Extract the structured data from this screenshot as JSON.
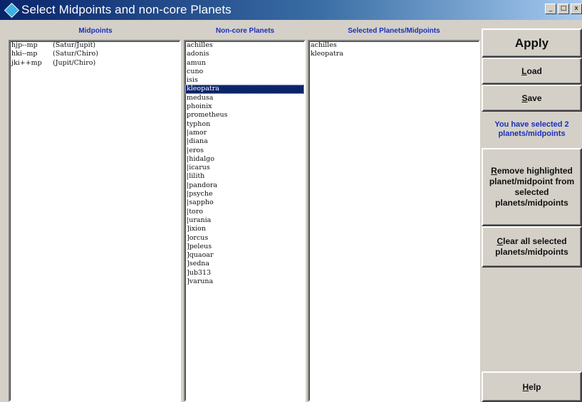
{
  "window": {
    "title": "Select Midpoints and non-core Planets",
    "controls": [
      "_",
      "□",
      "x"
    ]
  },
  "headers": {
    "midpoints": "Midpoints",
    "noncore": "Non-core Planets",
    "selected": "Selected Planets/Midpoints"
  },
  "midpoints": [
    {
      "name": "hjp--mp",
      "pair": "(Satur/Jupit)"
    },
    {
      "name": "hki--mp",
      "pair": "(Satur/Chiro)"
    },
    {
      "name": "jki++mp",
      "pair": "(Jupit/Chiro)"
    }
  ],
  "noncore": [
    "achilles",
    "adonis",
    "amun",
    "cuno",
    "isis",
    "kleopatra",
    "medusa",
    "phoinix",
    "prometheus",
    "typhon",
    "|amor",
    "|diana",
    "|eros",
    "|hidalgo",
    "|icarus",
    "|lilith",
    "|pandora",
    "|psyche",
    "|sappho",
    "|toro",
    "|urania",
    "]ixion",
    "]orcus",
    "]peleus",
    "]quaoar",
    "]sedna",
    "]ub313",
    "]varuna"
  ],
  "noncore_selected_index": 5,
  "selected": [
    "achilles",
    "kleopatra"
  ],
  "buttons": {
    "apply": "Apply",
    "load_pre": "",
    "load_key": "L",
    "load_post": "oad",
    "save_key": "S",
    "save_post": "ave",
    "remove_key": "R",
    "remove_post": "emove highlighted planet/midpoint from selected planets/midpoints",
    "clear_key": "C",
    "clear_post": "lear all selected planets/midpoints",
    "help_key": "H",
    "help_post": "elp"
  },
  "status": "You have selected 2 planets/midpoints",
  "colors": {
    "title_gradient_start": "#0a246a",
    "header_blue": "#1c30b8",
    "selection": "#0a246a"
  }
}
